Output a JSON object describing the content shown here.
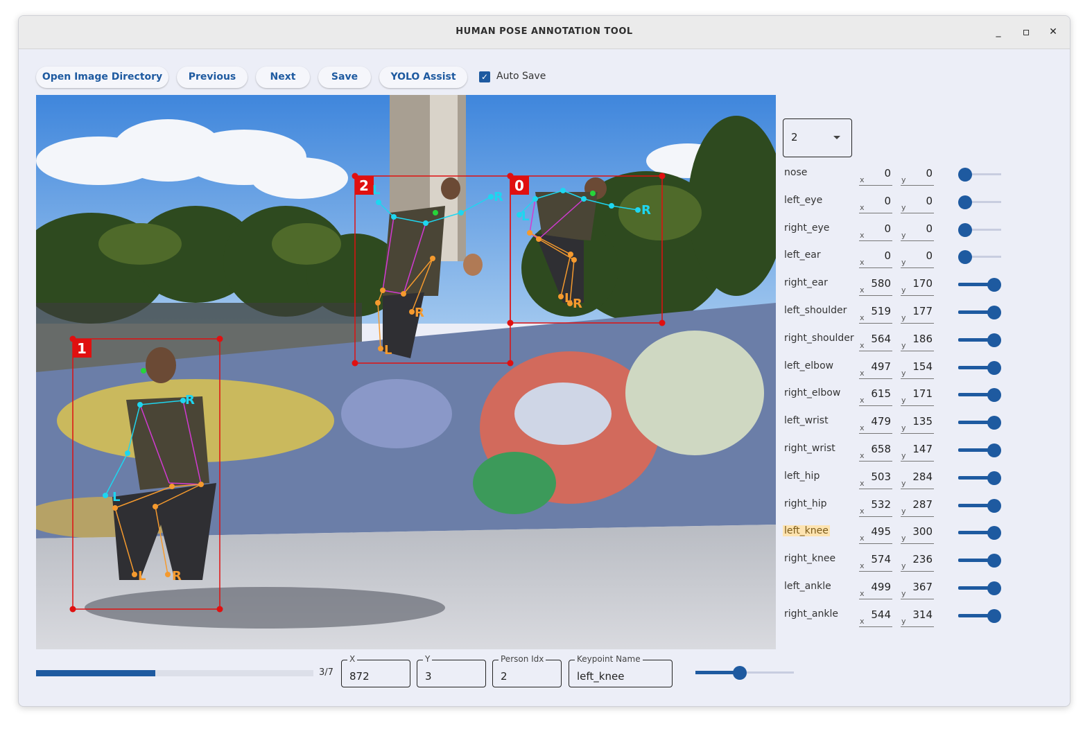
{
  "window": {
    "title": "HUMAN POSE ANNOTATION TOOL",
    "minimize": "_",
    "maximize": "▫",
    "close": "✕"
  },
  "toolbar": {
    "open_dir": "Open Image Directory",
    "previous": "Previous",
    "next": "Next",
    "save": "Save",
    "yolo": "YOLO Assist",
    "auto_save_label": "Auto Save",
    "auto_save_checked": true
  },
  "canvas": {
    "boxes": [
      {
        "label": "0",
        "color": "#e01010"
      },
      {
        "label": "1",
        "color": "#e01010"
      },
      {
        "label": "2",
        "color": "#e01010"
      }
    ],
    "left_marker": "L",
    "right_marker": "R"
  },
  "person_select": {
    "value": "2"
  },
  "keypoints": [
    {
      "name": "nose",
      "x": "0",
      "y": "0",
      "level": 0
    },
    {
      "name": "left_eye",
      "x": "0",
      "y": "0",
      "level": 0
    },
    {
      "name": "right_eye",
      "x": "0",
      "y": "0",
      "level": 0
    },
    {
      "name": "left_ear",
      "x": "0",
      "y": "0",
      "level": 0
    },
    {
      "name": "right_ear",
      "x": "580",
      "y": "170",
      "level": 1
    },
    {
      "name": "left_shoulder",
      "x": "519",
      "y": "177",
      "level": 1
    },
    {
      "name": "right_shoulder",
      "x": "564",
      "y": "186",
      "level": 1
    },
    {
      "name": "left_elbow",
      "x": "497",
      "y": "154",
      "level": 1
    },
    {
      "name": "right_elbow",
      "x": "615",
      "y": "171",
      "level": 1
    },
    {
      "name": "left_wrist",
      "x": "479",
      "y": "135",
      "level": 1
    },
    {
      "name": "right_wrist",
      "x": "658",
      "y": "147",
      "level": 1
    },
    {
      "name": "left_hip",
      "x": "503",
      "y": "284",
      "level": 1
    },
    {
      "name": "right_hip",
      "x": "532",
      "y": "287",
      "level": 1
    },
    {
      "name": "left_knee",
      "x": "495",
      "y": "300",
      "level": 1,
      "highlighted": true
    },
    {
      "name": "right_knee",
      "x": "574",
      "y": "236",
      "level": 1
    },
    {
      "name": "left_ankle",
      "x": "499",
      "y": "367",
      "level": 1
    },
    {
      "name": "right_ankle",
      "x": "544",
      "y": "314",
      "level": 1
    }
  ],
  "coord_labels": {
    "x": "x",
    "y": "y"
  },
  "status": {
    "progress_text": "3/7",
    "progress_fraction": 0.43,
    "x_label": "X",
    "x_value": "872",
    "y_label": "Y",
    "y_value": "3",
    "person_idx_label": "Person Idx",
    "person_idx_value": "2",
    "keypoint_name_label": "Keypoint Name",
    "keypoint_name_value": "left_knee",
    "zoom_level": 0.45
  }
}
